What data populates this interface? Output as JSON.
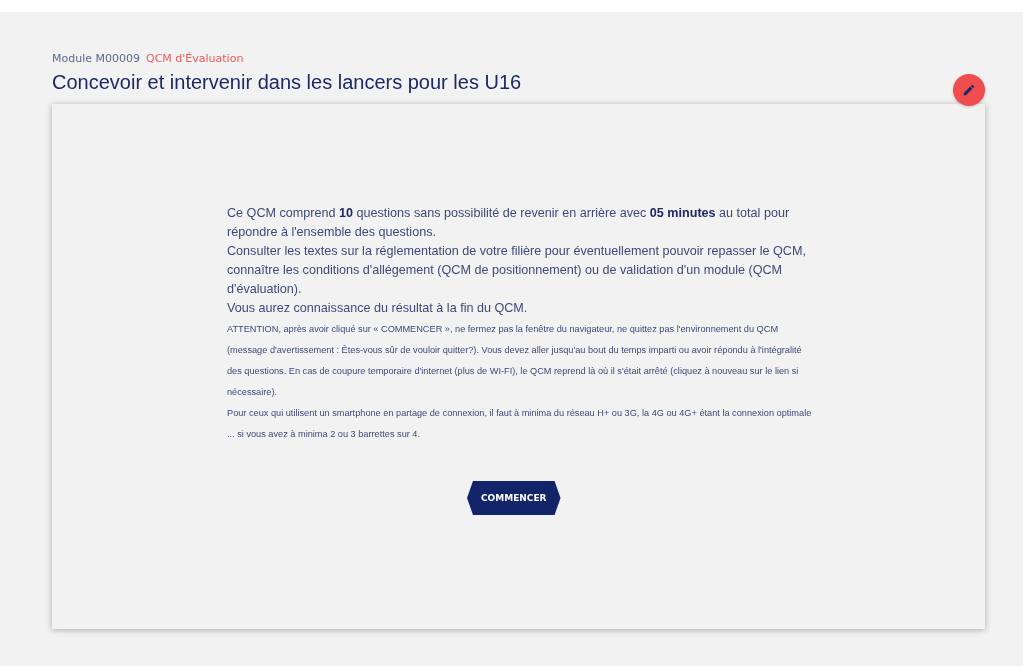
{
  "header": {
    "module": "Module M00009",
    "module_type": "QCM d'Évaluation",
    "title": "Concevoir et intervenir dans les lancers pour les U16"
  },
  "paragraphs": [
    {
      "kind": "normal",
      "text": "Ce QCM comprend **10** questions sans possibilité de revenir en arrière avec **05 minutes** au total pour répondre à l'ensemble des questions."
    },
    {
      "kind": "normal",
      "text": "Consulter les textes sur la réglementation de votre filière pour éventuellement pouvoir repasser le QCM, connaître les conditions d'allégement (QCM de positionnement) ou de validation d'un module (QCM d'évaluation)."
    },
    {
      "kind": "normal",
      "text": "Vous aurez connaissance du résultat à la fin du QCM."
    },
    {
      "kind": "small",
      "text": "ATTENTION, après avoir cliqué sur « COMMENCER », ne fermez pas la fenêtre du navigateur, ne quittez pas l'environnement du QCM (message d'avertissement : Êtes-vous sûr de vouloir quitter?). Vous devez aller jusqu'au bout du temps imparti ou avoir répondu à l'intégralité des questions. En cas de coupure temporaire d'internet (plus de WI-FI), le QCM reprend là où il s'était arrêté (cliquez à nouveau sur le lien si nécessaire)."
    },
    {
      "kind": "small",
      "text": "Pour ceux qui utilisent un smartphone en partage de connexion, il faut à minima du réseau H+ ou 3G, la 4G ou 4G+ étant la connexion optimale ... si vous avez à minima 2 ou 3 barrettes sur 4."
    }
  ],
  "start_button": "COMMENCER"
}
